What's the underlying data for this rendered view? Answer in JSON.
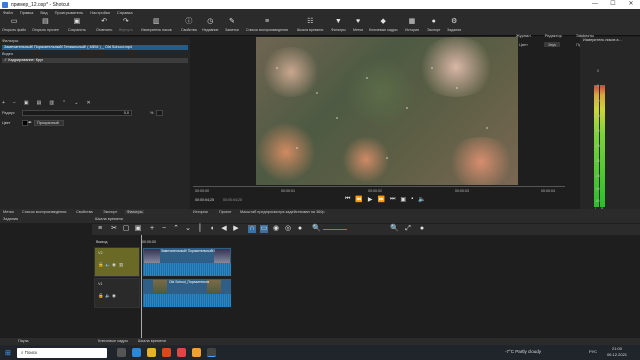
{
  "window": {
    "title": "пример_12.osp* - Shotcut",
    "controls": [
      "—",
      "☐",
      "✕"
    ]
  },
  "menu": [
    "Файл",
    "Правка",
    "Вид",
    "Проигрыватель",
    "Настройки",
    "Справка"
  ],
  "toolbar": [
    {
      "label": "Открыть файл",
      "icon": "folder-icon"
    },
    {
      "label": "Открыть прочее",
      "icon": "open-other-icon"
    },
    {
      "label": "Сохранить",
      "icon": "save-icon"
    },
    {
      "label": "Отменить",
      "icon": "undo-icon"
    },
    {
      "label": "Вернуть",
      "icon": "redo-icon"
    },
    {
      "label": "Измеритель пиков",
      "icon": "peak-meter-icon"
    },
    {
      "label": "Свойства",
      "icon": "info-icon"
    },
    {
      "label": "Недавние",
      "icon": "recent-icon"
    },
    {
      "label": "Заметки",
      "icon": "notes-icon"
    },
    {
      "label": "Список воспроизведения",
      "icon": "playlist-icon"
    },
    {
      "label": "Шкала времени",
      "icon": "timeline-icon"
    },
    {
      "label": "Фильтры",
      "icon": "filter-icon"
    },
    {
      "label": "Метки",
      "icon": "markers-icon"
    },
    {
      "label": "Ключевые кадры",
      "icon": "keyframes-icon"
    },
    {
      "label": "История",
      "icon": "history-icon"
    },
    {
      "label": "Экспорт",
      "icon": "export-icon"
    },
    {
      "label": "Задания",
      "icon": "jobs-icon"
    }
  ],
  "layouts": {
    "top": [
      "Журнал",
      "Редактор",
      "Эффекты"
    ],
    "sub": [
      "Цвет",
      "Звук",
      "Программист"
    ],
    "active_sub": "Звук"
  },
  "filters": {
    "title": "Фильтры",
    "clip_label": "Замечательный! Поразительный! Гениальный! ( МЕМ ) _ Old School.mp4",
    "section": "Видео",
    "items": [
      "✓ Кадрирование: Круг"
    ],
    "radius_label": "Радиус",
    "radius_value": "0,0",
    "radius_unit": "%",
    "color_label": "Цвет",
    "transparent_label": "Прозрачный"
  },
  "player": {
    "time_current": "00:00:04;25",
    "time_total": "00:00:04;25",
    "ruler": [
      "00:00:00",
      "00:00:01",
      "00:00:02",
      "00:00:03",
      "00:00:04"
    ]
  },
  "meter": {
    "title": "Измеритель пиков а...",
    "scale": [
      "0",
      "-5",
      "-10",
      "-15",
      "-20",
      "-25",
      "-30",
      "-35",
      "-40",
      "-50"
    ],
    "channels": [
      "L",
      "R"
    ],
    "levels": [
      0.87,
      0.87
    ]
  },
  "tabs_left": [
    "Метки",
    "Список воспроизведения",
    "Свойства",
    "Экспорт",
    "Фильтры"
  ],
  "tabs_right": [
    "История",
    "Проект",
    "Масштаб предпросмотра задействован на 360p"
  ],
  "jobs_title": "Задания",
  "timeline_title": "Шкала времени",
  "output_label": "Вывод",
  "ruler_start": "00:00:00",
  "tracks": [
    {
      "name": "V2",
      "clip": "Замечательный! Поразительный! Гени..."
    },
    {
      "name": "V1",
      "clip": "Old School_Поразительный! Ге..."
    }
  ],
  "status_tabs": [
    "Пауза",
    "Ключевые кадры",
    "Шкала времени"
  ],
  "taskbar": {
    "search": "Поиск",
    "weather": "-7°C  Partly cloudy",
    "lang": "РУС",
    "time": "21:00",
    "date": "06.12.2021"
  }
}
